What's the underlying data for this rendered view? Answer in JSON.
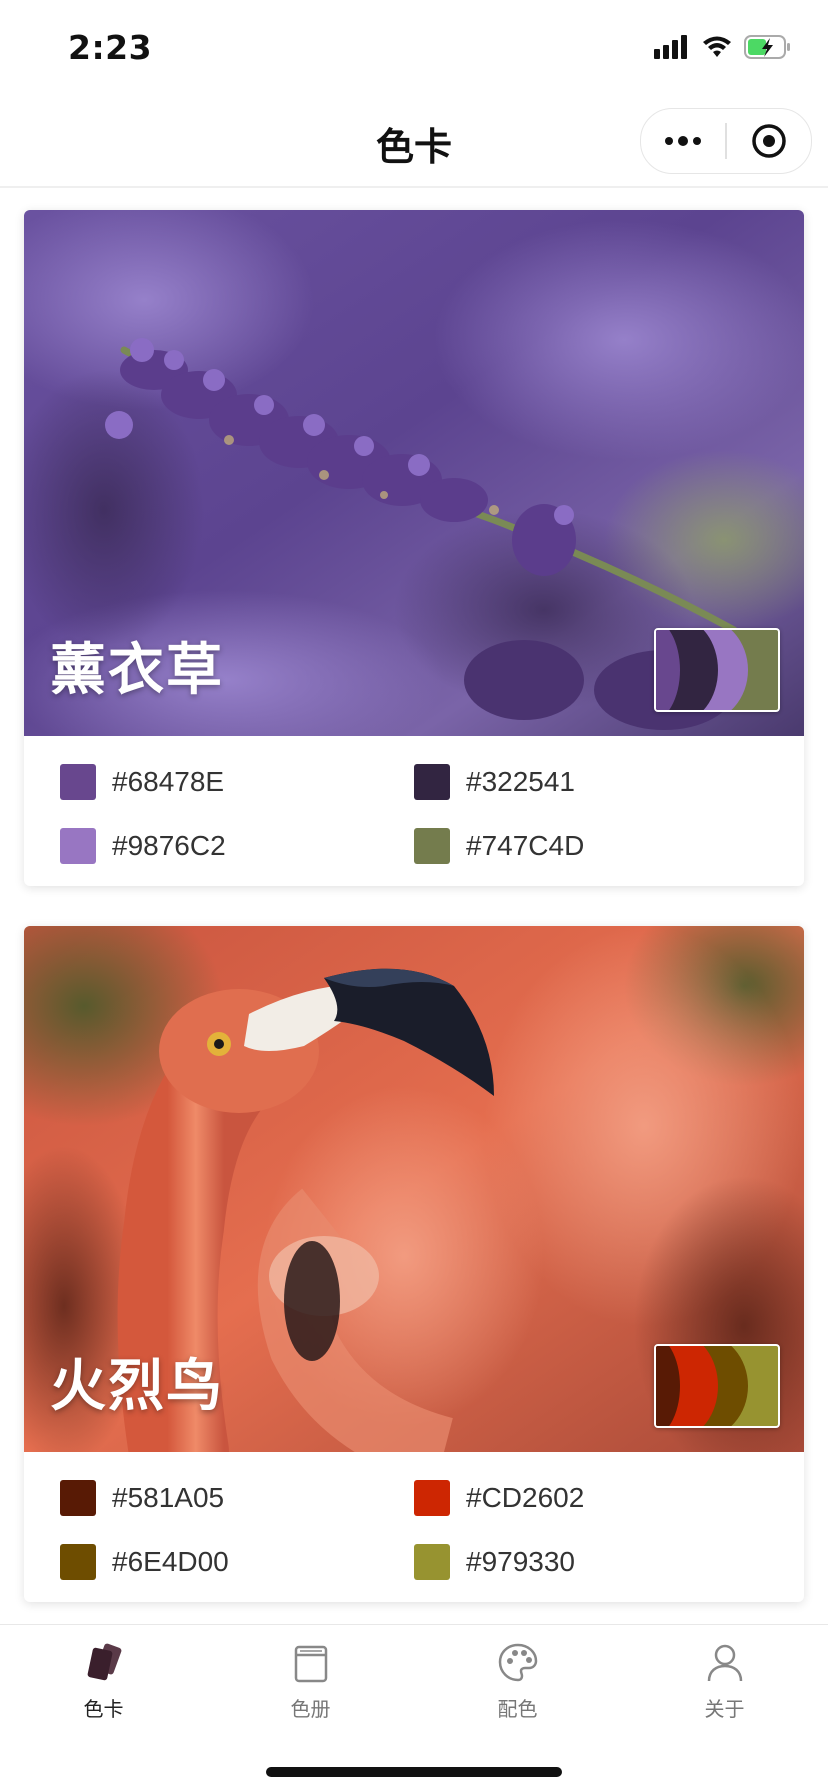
{
  "status_bar": {
    "time": "2:23"
  },
  "nav": {
    "title": "色卡"
  },
  "cards": [
    {
      "title": "薰衣草",
      "photo_subject": "lavender-flowers",
      "swatches": [
        {
          "hex": "#68478E",
          "label": "#68478E"
        },
        {
          "hex": "#322541",
          "label": "#322541"
        },
        {
          "hex": "#9876C2",
          "label": "#9876C2"
        },
        {
          "hex": "#747C4D",
          "label": "#747C4D"
        }
      ]
    },
    {
      "title": "火烈鸟",
      "photo_subject": "flamingo",
      "swatches": [
        {
          "hex": "#581A05",
          "label": "#581A05"
        },
        {
          "hex": "#CD2602",
          "label": "#CD2602"
        },
        {
          "hex": "#6E4D00",
          "label": "#6E4D00"
        },
        {
          "hex": "#979330",
          "label": "#979330"
        }
      ]
    }
  ],
  "tab_bar": {
    "tabs": [
      {
        "label": "色卡",
        "icon": "cards-icon",
        "active": true
      },
      {
        "label": "色册",
        "icon": "album-icon",
        "active": false
      },
      {
        "label": "配色",
        "icon": "palette-icon",
        "active": false
      },
      {
        "label": "关于",
        "icon": "user-icon",
        "active": false
      }
    ]
  }
}
